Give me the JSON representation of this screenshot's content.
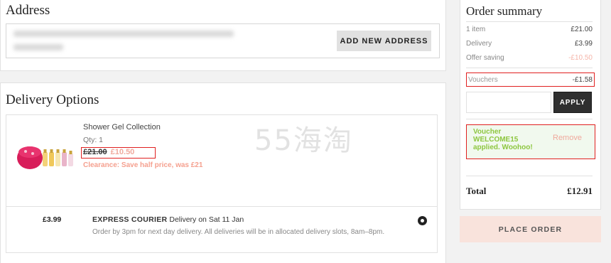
{
  "address": {
    "title": "Address",
    "add_button": "ADD NEW ADDRESS"
  },
  "delivery": {
    "title": "Delivery Options",
    "product": {
      "name": "Shower Gel Collection",
      "qty": "Qty: 1",
      "price_old": "£21.00",
      "price_new": "£10.50",
      "clearance": "Clearance: Save half price, was £21"
    },
    "shipping": {
      "price": "£3.99",
      "method": "EXPRESS COURIER",
      "date": "Delivery on Sat 11 Jan",
      "description": "Order by 3pm for next day delivery. All deliveries will be in allocated delivery slots, 8am–8pm."
    }
  },
  "summary": {
    "title": "Order summary",
    "lines": [
      {
        "label": "1 item",
        "value": "£21.00"
      },
      {
        "label": "Delivery",
        "value": "£3.99"
      },
      {
        "label": "Offer saving",
        "value": "-£10.50"
      }
    ],
    "voucher": {
      "label": "Vouchers",
      "value": "-£1.58"
    },
    "apply_button": "APPLY",
    "applied_message": "Voucher WELCOME15 applied. Woohoo!",
    "remove_link": "Remove",
    "total": {
      "label": "Total",
      "value": "£12.91"
    },
    "place_order": "PLACE ORDER"
  },
  "watermark": "55海淘",
  "colors": {
    "accent_red": "#e02020",
    "sale_pink": "#f5a08f",
    "success_green": "#8dc63f",
    "place_order_bg": "#f9e3dc"
  }
}
